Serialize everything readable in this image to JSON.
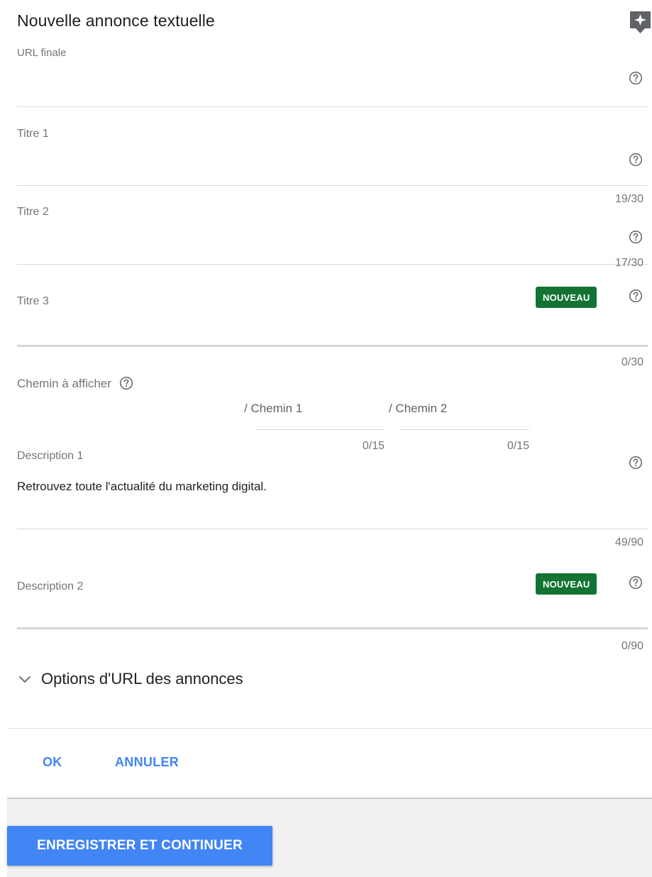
{
  "title": "Nouvelle annonce textuelle",
  "badge": "NOUVEAU",
  "fields": {
    "final_url": {
      "label": "URL finale"
    },
    "title1": {
      "label": "Titre 1",
      "counter": "19/30"
    },
    "title2": {
      "label": "Titre 2",
      "counter": "17/30"
    },
    "title3": {
      "label": "Titre 3",
      "counter": "0/30"
    },
    "path": {
      "label": "Chemin à afficher",
      "path1": {
        "placeholder": "/ Chemin 1",
        "counter": "0/15"
      },
      "path2": {
        "placeholder": "/ Chemin 2",
        "counter": "0/15"
      }
    },
    "description1": {
      "label": "Description 1",
      "value": "Retrouvez toute l'actualité du marketing digital.",
      "counter": "49/90"
    },
    "description2": {
      "label": "Description 2",
      "counter": "0/90"
    }
  },
  "url_options": "Options d'URL des annonces",
  "actions": {
    "ok": "OK",
    "cancel": "ANNULER"
  },
  "footer": {
    "save_continue": "ENREGISTRER ET CONTINUER"
  },
  "colors": {
    "accent": "#4285f4",
    "badge_green": "#137333"
  },
  "icons": {
    "help": "help-circle-icon",
    "chevron": "chevron-down-icon",
    "hint": "sparkle-hint-icon"
  }
}
